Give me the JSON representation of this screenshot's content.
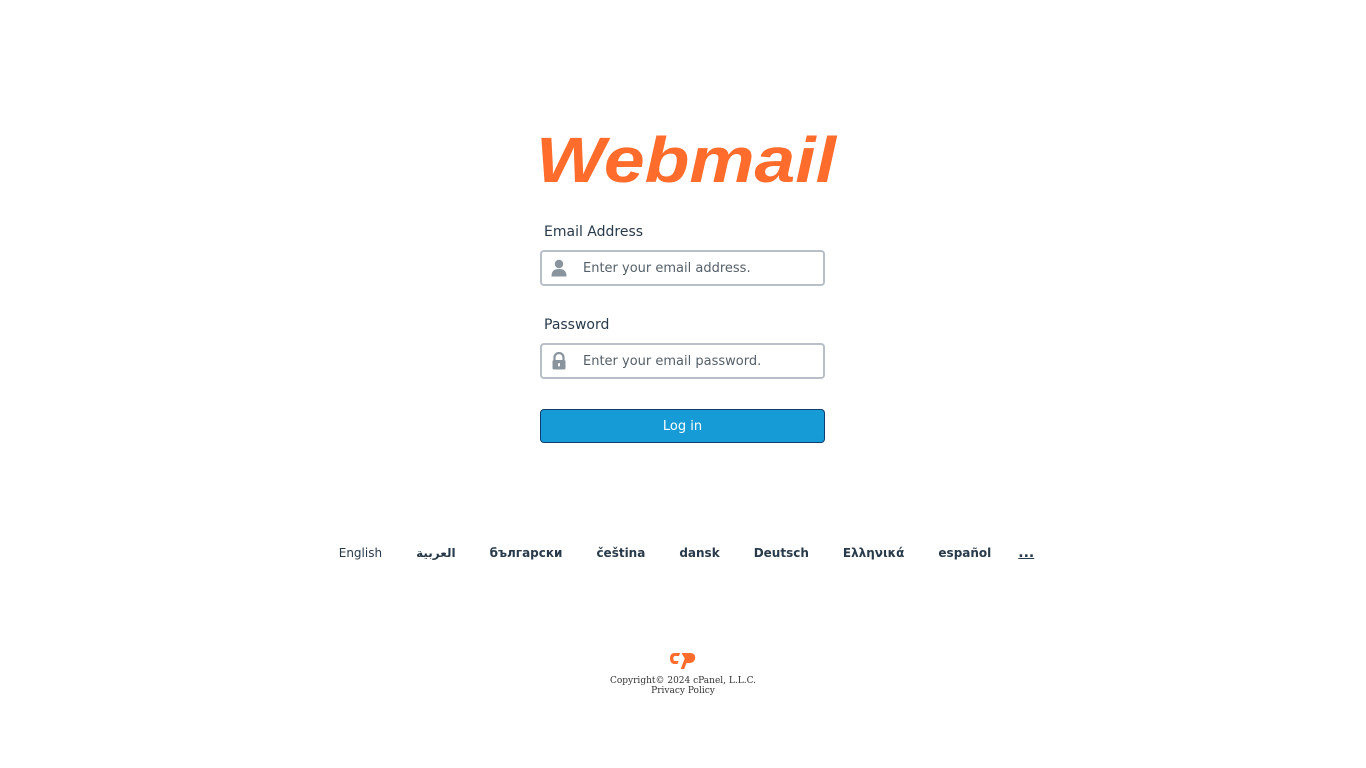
{
  "logo": {
    "text": "Webmail",
    "color": "#ff6c2c"
  },
  "form": {
    "email_label": "Email Address",
    "email_placeholder": "Enter your email address.",
    "email_icon": "user-icon",
    "password_label": "Password",
    "password_placeholder": "Enter your email password.",
    "password_icon": "lock-icon",
    "login_label": "Log in",
    "login_color": "#179bd7"
  },
  "languages": {
    "items": [
      "English",
      "العربية",
      "български",
      "čeština",
      "dansk",
      "Deutsch",
      "Ελληνικά",
      "español"
    ],
    "more": "..."
  },
  "footer": {
    "brand_icon": "cpanel-logo-icon",
    "copyright": "Copyright© 2024 cPanel, L.L.C.",
    "privacy": "Privacy Policy"
  }
}
